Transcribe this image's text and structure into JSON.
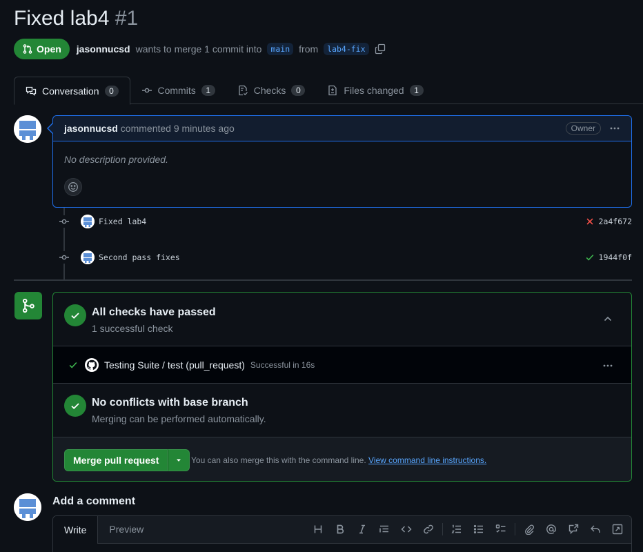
{
  "pr": {
    "title": "Fixed lab4",
    "number": "#1",
    "state": "Open",
    "author": "jasonnucsd",
    "merge_text_1": "wants to merge 1 commit into",
    "base_branch": "main",
    "merge_text_2": "from",
    "head_branch": "lab4-fix"
  },
  "tabs": [
    {
      "label": "Conversation",
      "count": "0",
      "icon": "comment-discussion-icon"
    },
    {
      "label": "Commits",
      "count": "1",
      "icon": "git-commit-icon"
    },
    {
      "label": "Checks",
      "count": "0",
      "icon": "checklist-icon"
    },
    {
      "label": "Files changed",
      "count": "1",
      "icon": "file-diff-icon"
    }
  ],
  "comment": {
    "author": "jasonnucsd",
    "action": "commented 9 minutes ago",
    "badge": "Owner",
    "body": "No description provided."
  },
  "commits": [
    {
      "message": "Fixed lab4",
      "sha": "2a4f672",
      "status": "failure"
    },
    {
      "message": "Second pass fixes",
      "sha": "1944f0f",
      "status": "success"
    }
  ],
  "merge_box": {
    "checks_title": "All checks have passed",
    "checks_sub": "1 successful check",
    "check_name": "Testing Suite / test (pull_request)",
    "check_time": "Successful in 16s",
    "conflicts_title": "No conflicts with base branch",
    "conflicts_sub": "Merging can be performed automatically.",
    "merge_button": "Merge pull request",
    "hint": "You can also merge this with the command line.",
    "hint_link": "View command line instructions."
  },
  "add_comment": {
    "title": "Add a comment",
    "tab_write": "Write",
    "tab_preview": "Preview"
  },
  "colors": {
    "open_green": "#238636",
    "accent_blue": "#1f6feb",
    "link_blue": "#58a6ff",
    "fail_red": "#f85149",
    "bg": "#0d1117"
  }
}
